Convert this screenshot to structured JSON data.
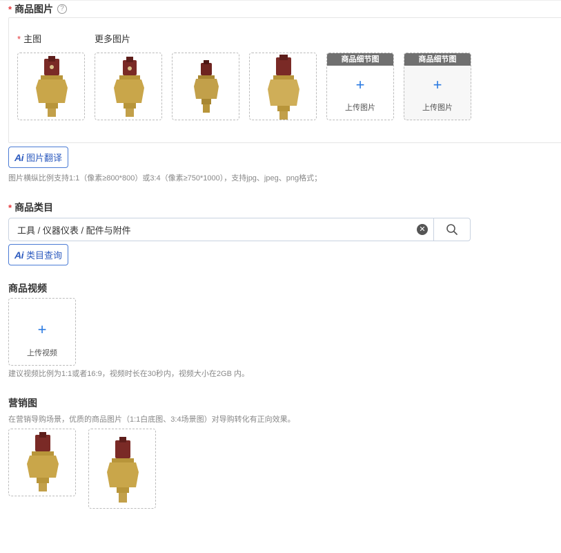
{
  "product_images": {
    "required_mark": "*",
    "title": "商品图片",
    "help_icon": "?",
    "main_label": "主图",
    "more_label": "更多图片",
    "detail_tag": "商品细节图",
    "upload_text": "上传图片",
    "ai_icon": "Ai",
    "ai_translate_label": "图片翻译",
    "hint": "图片横纵比例支持1:1（像素≥800*800）或3:4（像素≥750*1000），支持jpg、jpeg、png格式；"
  },
  "category": {
    "required_mark": "*",
    "title": "商品类目",
    "value": "工具 / 仪器仪表 / 配件与附件",
    "clear_icon": "✕",
    "ai_icon": "Ai",
    "ai_query_label": "类目查询"
  },
  "video": {
    "title": "商品视频",
    "plus": "+",
    "upload_text": "上传视频",
    "hint": "建议视频比例为1:1或者16:9，视频时长在30秒内，视频大小在2GB 内。"
  },
  "marketing": {
    "title": "营销图",
    "hint": "在营销导购场景，优质的商品图片（1:1白底图、3:4场景图）对导购转化有正向效果。"
  },
  "colors": {
    "required": "#e4393c",
    "accent_blue": "#2a7ae2",
    "ai_blue": "#2d5bbf",
    "tag_gray": "#707070"
  }
}
